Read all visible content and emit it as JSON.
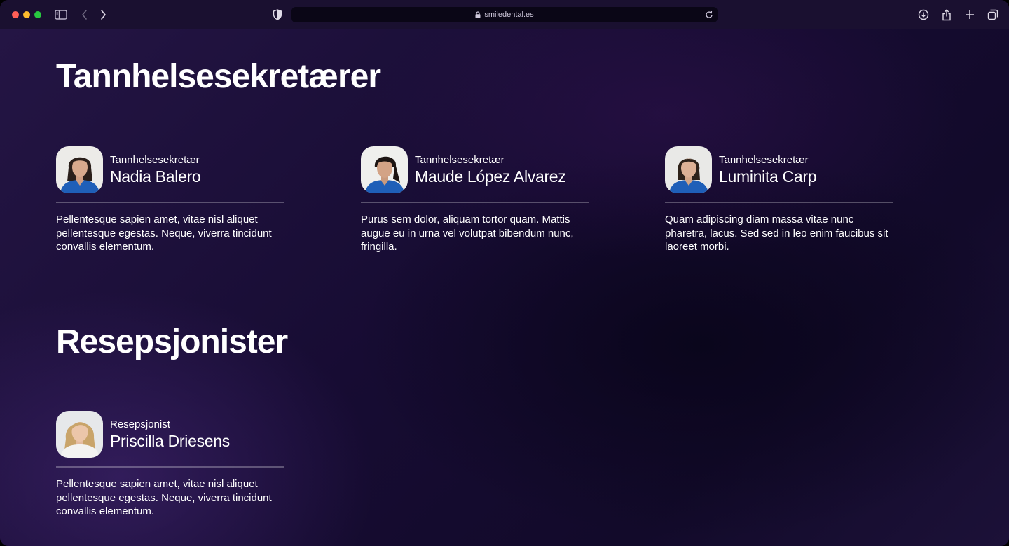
{
  "browser": {
    "url": "smiledental.es"
  },
  "sections": [
    {
      "title": "Tannhelsesekretærer",
      "members": [
        {
          "role": "Tannhelsesekretær",
          "name": "Nadia Balero",
          "description": "Pellentesque sapien amet, vitae nisl aliquet pellentesque egestas. Neque, viverra tincidunt convallis elementum."
        },
        {
          "role": "Tannhelsesekretær",
          "name": "Maude López Alvarez",
          "description": "Purus sem dolor, aliquam tortor quam. Mattis augue eu in urna vel volutpat bibendum nunc, fringilla."
        },
        {
          "role": "Tannhelsesekretær",
          "name": "Luminita Carp",
          "description": "Quam adipiscing diam massa vitae nunc pharetra, lacus. Sed sed in leo enim faucibus sit laoreet morbi."
        }
      ]
    },
    {
      "title": "Resepsjonister",
      "members": [
        {
          "role": "Resepsjonist",
          "name": "Priscilla Driesens",
          "description": "Pellentesque sapien amet, vitae nisl aliquet pellentesque egestas. Neque, viverra tincidunt convallis elementum."
        }
      ]
    }
  ],
  "colors": {
    "background": "#170c33",
    "text": "#ffffff",
    "uniform": "#1f5fb8"
  }
}
